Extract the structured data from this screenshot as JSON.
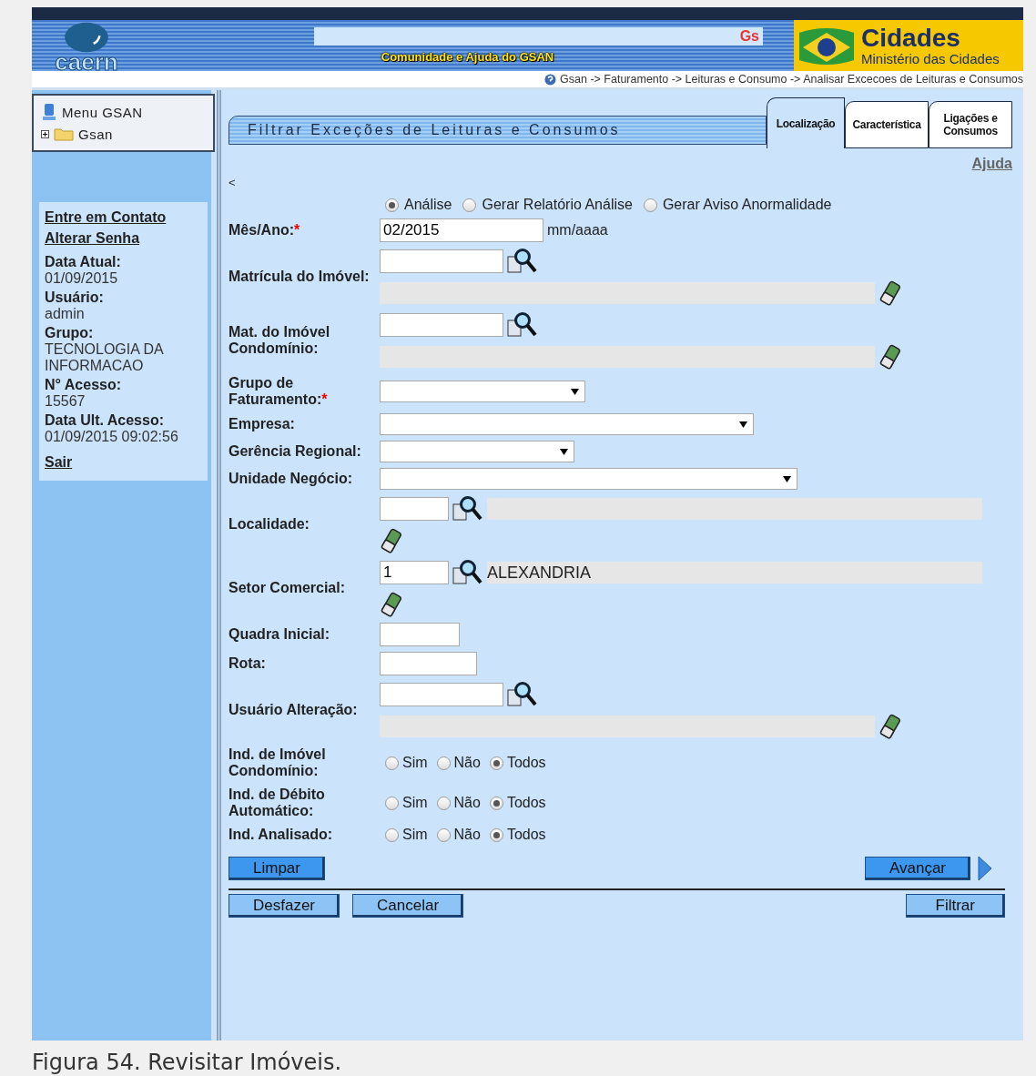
{
  "header": {
    "logo": "caern",
    "search_text": "Gs",
    "community_link": "Comunidade e Ajuda do GSAN",
    "ministry_title": "Cidades",
    "ministry_subtitle": "Ministério das Cidades",
    "breadcrumb": "Gsan -> Faturamento -> Leituras e Consumo -> Analisar Excecoes de Leituras e Consumos"
  },
  "sidebar": {
    "menu": {
      "title": "Menu GSAN",
      "items": [
        {
          "label": "Gsan",
          "expanded": false
        }
      ]
    },
    "links_top": [
      "Entre em Contato",
      "Alterar Senha"
    ],
    "info": [
      {
        "label": "Data Atual:",
        "value": "01/09/2015"
      },
      {
        "label": "Usuário:",
        "value": "admin"
      },
      {
        "label": "Grupo:",
        "value": "TECNOLOGIA DA INFORMACAO"
      },
      {
        "label": "N° Acesso:",
        "value": "15567"
      },
      {
        "label": "Data Ult. Acesso:",
        "value": "01/09/2015 09:02:56"
      }
    ],
    "logout": "Sair"
  },
  "form": {
    "title": "Filtrar Exceções de Leituras e Consumos",
    "tabs": [
      {
        "label": "Localização",
        "selected": true
      },
      {
        "label": "Característica",
        "selected": false
      },
      {
        "label": "Ligações e Consumos",
        "selected": false
      }
    ],
    "help_link": "Ajuda",
    "back": "<",
    "mode_options": [
      {
        "label": "Análise",
        "selected": true
      },
      {
        "label": "Gerar Relatório Análise",
        "selected": false
      },
      {
        "label": "Gerar Aviso Anormalidade",
        "selected": false
      }
    ],
    "fields": [
      {
        "kind": "text",
        "label": "Mês/Ano:",
        "required_mark": "*",
        "value": "02/2015",
        "hint": "mm/aaaa"
      },
      {
        "kind": "lookup",
        "label": "Matrícula do Imóvel:"
      },
      {
        "kind": "lookup",
        "label": "Mat. do Imóvel Condomínio:"
      },
      {
        "kind": "select",
        "label": "Grupo de Faturamento:",
        "required_mark": "*"
      },
      {
        "kind": "select",
        "label": "Empresa:"
      },
      {
        "kind": "select",
        "label": "Gerência Regional:"
      },
      {
        "kind": "select",
        "label": "Unidade Negócio:"
      },
      {
        "kind": "lookup-inline",
        "label": "Localidade:"
      },
      {
        "kind": "lookup-inline",
        "label": "Setor Comercial:",
        "value": "1",
        "description": "ALEXANDRIA"
      },
      {
        "kind": "text",
        "label": "Quadra Inicial:"
      },
      {
        "kind": "text",
        "label": "Rota:"
      },
      {
        "kind": "lookup",
        "label": "Usuário Alteração:"
      },
      {
        "kind": "radio",
        "label": "Ind. de Imóvel Condomínio:",
        "options": [
          {
            "label": "Sim",
            "selected": false
          },
          {
            "label": "Não",
            "selected": false
          },
          {
            "label": "Todos",
            "selected": true
          }
        ]
      },
      {
        "kind": "radio",
        "label": "Ind. de Débito Automático:",
        "options": [
          {
            "label": "Sim",
            "selected": false
          },
          {
            "label": "Não",
            "selected": false
          },
          {
            "label": "Todos",
            "selected": true
          }
        ]
      },
      {
        "kind": "radio",
        "label": "Ind. Analisado:",
        "options": [
          {
            "label": "Sim",
            "selected": false
          },
          {
            "label": "Não",
            "selected": false
          },
          {
            "label": "Todos",
            "selected": true
          }
        ]
      }
    ],
    "buttons_top": [
      "Limpar",
      "Avançar"
    ],
    "buttons_bottom": [
      "Desfazer",
      "Cancelar",
      "Filtrar"
    ]
  },
  "caption": "Figura 54. Revisitar Imóveis."
}
